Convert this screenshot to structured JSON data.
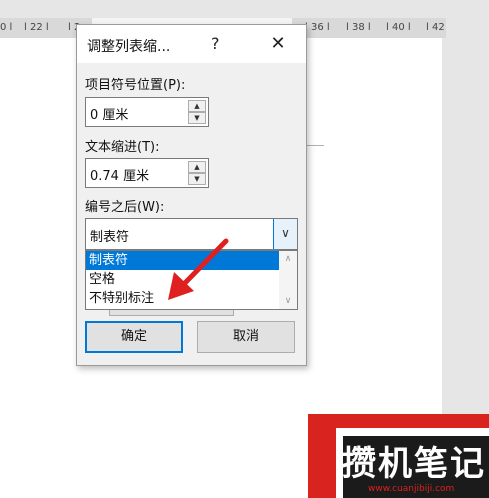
{
  "ruler": {
    "marks": [
      "0 l",
      "l 22 l",
      "l 2",
      "l 36 l",
      "l 38 l",
      "l 40 l",
      "l 42"
    ]
  },
  "dialog": {
    "title": "调整列表缩...",
    "help_label": "?",
    "close_label": "✕",
    "bullet_position": {
      "label": "项目符号位置(P):",
      "value": "0 厘米"
    },
    "text_indent": {
      "label": "文本缩进(T):",
      "value": "0.74 厘米"
    },
    "follow_number": {
      "label": "编号之后(W):",
      "selected": "制表符",
      "options": [
        "制表符",
        "空格",
        "不特别标注"
      ]
    },
    "ok_label": "确定",
    "cancel_label": "取消"
  },
  "watermark": {
    "text": "攒机笔记",
    "url": "www.cuanjibiji.com"
  },
  "colors": {
    "selection": "#0078d7",
    "arrow": "#e02020",
    "logo_red": "#d9231f"
  }
}
